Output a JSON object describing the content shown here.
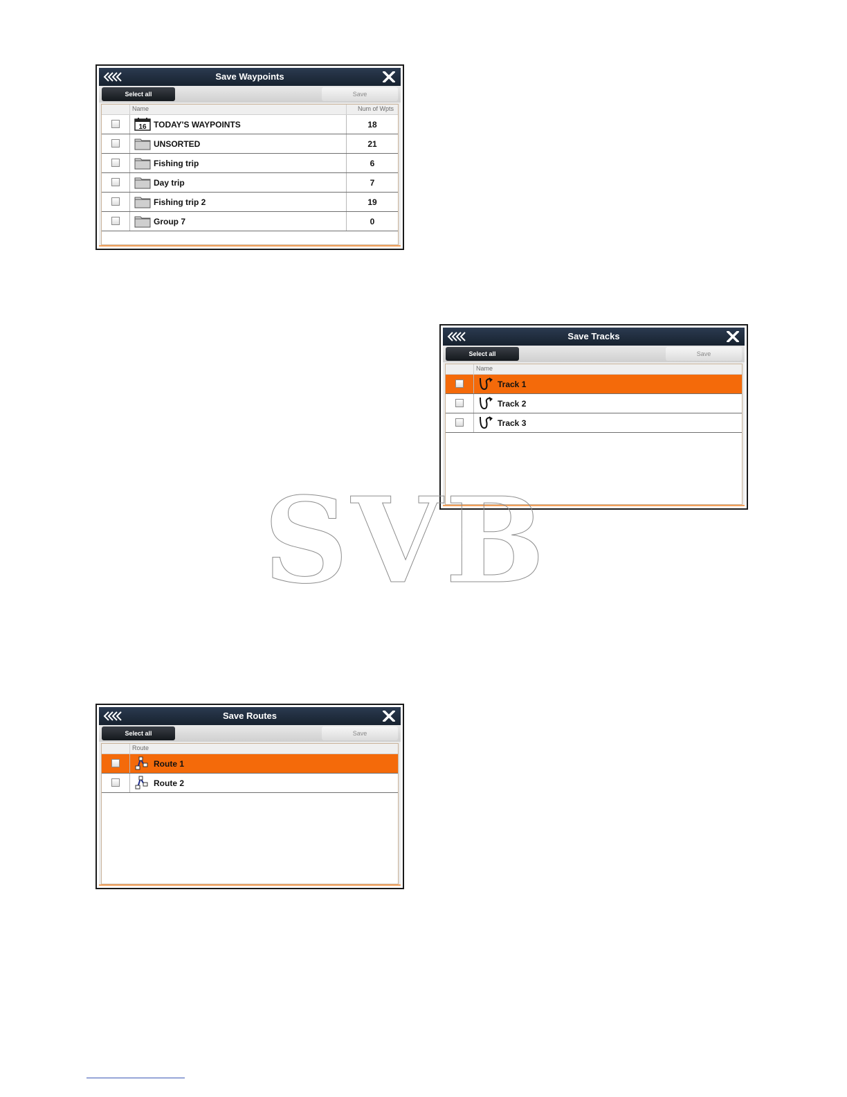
{
  "waypoints_dialog": {
    "title": "Save Waypoints",
    "select_all": "Select all",
    "save": "Save",
    "col_name": "Name",
    "col_num": "Num of Wpts",
    "rows": [
      {
        "name": "TODAY'S WAYPOINTS",
        "num": "18",
        "icon": "calendar-icon",
        "calendar_day": "16"
      },
      {
        "name": "UNSORTED",
        "num": "21",
        "icon": "folder-icon"
      },
      {
        "name": "Fishing trip",
        "num": "6",
        "icon": "folder-icon"
      },
      {
        "name": "Day trip",
        "num": "7",
        "icon": "folder-icon"
      },
      {
        "name": "Fishing trip 2",
        "num": "19",
        "icon": "folder-icon"
      },
      {
        "name": "Group 7",
        "num": "0",
        "icon": "folder-icon"
      }
    ]
  },
  "tracks_dialog": {
    "title": "Save Tracks",
    "select_all": "Select all",
    "save": "Save",
    "col_name": "Name",
    "rows": [
      {
        "name": "Track 1",
        "selected": true,
        "icon": "track-icon"
      },
      {
        "name": "Track 2",
        "selected": false,
        "icon": "track-icon"
      },
      {
        "name": "Track 3",
        "selected": false,
        "icon": "track-icon"
      }
    ]
  },
  "routes_dialog": {
    "title": "Save Routes",
    "select_all": "Select all",
    "save": "Save",
    "col_name": "Route",
    "rows": [
      {
        "name": "Route 1",
        "selected": true,
        "icon": "route-icon"
      },
      {
        "name": "Route 2",
        "selected": false,
        "icon": "route-icon"
      }
    ]
  },
  "watermark": "SVB",
  "colors": {
    "titlebar": "#1f2b3b",
    "selected_row": "#f46a0a",
    "accent_border": "#f3a05a"
  }
}
